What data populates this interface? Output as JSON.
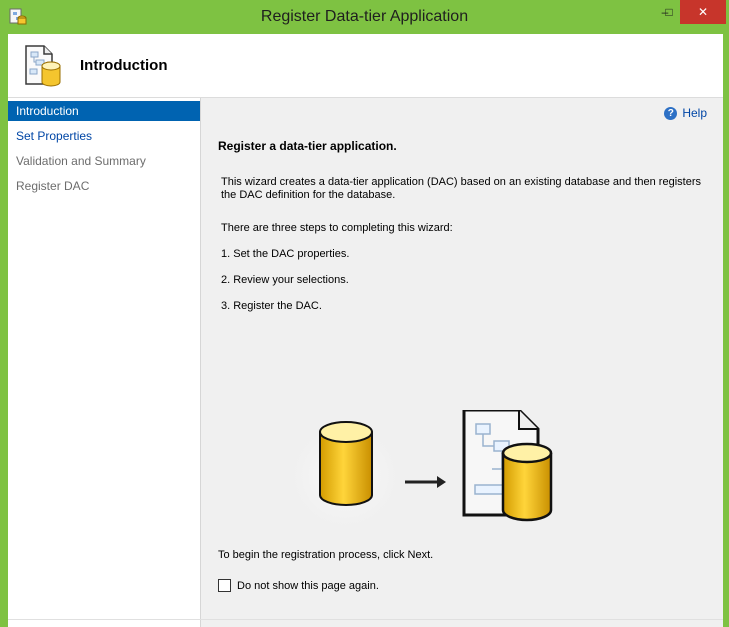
{
  "window": {
    "title": "Register Data-tier Application",
    "minimize": "–",
    "maximize": "□",
    "close": "✕"
  },
  "header": {
    "title": "Introduction"
  },
  "sidebar": {
    "items": [
      {
        "label": "Introduction",
        "state": "active"
      },
      {
        "label": "Set Properties",
        "state": "link"
      },
      {
        "label": "Validation and Summary",
        "state": "disabled"
      },
      {
        "label": "Register DAC",
        "state": "disabled"
      }
    ]
  },
  "content": {
    "help_label": "Help",
    "help_icon": "?",
    "heading": "Register a data-tier application.",
    "description": "This wizard creates a data-tier application (DAC) based on an existing database and then registers the DAC definition for the database.",
    "steps_intro": "There are three steps to completing this wizard:",
    "steps": [
      "1. Set the DAC properties.",
      "2. Review your selections.",
      "3. Register the DAC."
    ],
    "footer": "To begin the registration process, click Next.",
    "checkbox_label": "Do not show this page again."
  },
  "icons": {
    "app": "dac-app-icon",
    "header": "dac-document-database-icon",
    "arrow": "right-arrow-icon"
  },
  "colors": {
    "titlebar": "#7ec242",
    "active_nav": "#0063b1",
    "link": "#0046a6",
    "close": "#c7352b"
  }
}
